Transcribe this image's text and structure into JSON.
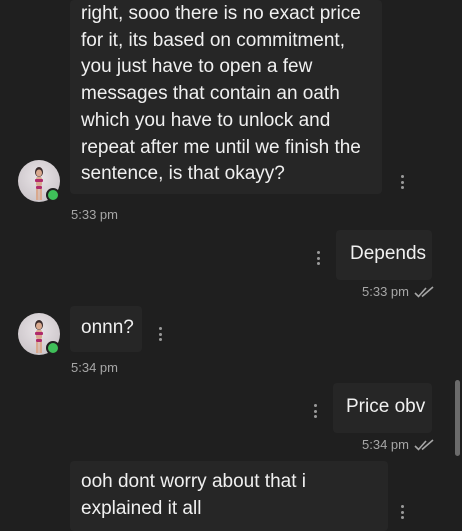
{
  "messages": {
    "m1": {
      "text": "right, sooo there is no exact price for it, its based on commitment, you just have to open a few messages that contain an oath which you have to unlock and repeat after me until we finish the sentence, is that okayy?",
      "time": "5:33 pm"
    },
    "m2": {
      "text": "Depends",
      "time": "5:33 pm",
      "status_icon": "double-check-icon"
    },
    "m3": {
      "text": "onnn?",
      "time": "5:34 pm"
    },
    "m4": {
      "text": "Price obv",
      "time": "5:34 pm",
      "status_icon": "double-check-icon"
    },
    "m5": {
      "text": "ooh dont worry about that i explained it all"
    }
  },
  "contact": {
    "online": true,
    "status_color": "#3fbf59"
  },
  "colors": {
    "background": "#1f1f1f",
    "bubble": "#262626",
    "text": "#f0f0f0",
    "meta": "#a6a6a6"
  }
}
